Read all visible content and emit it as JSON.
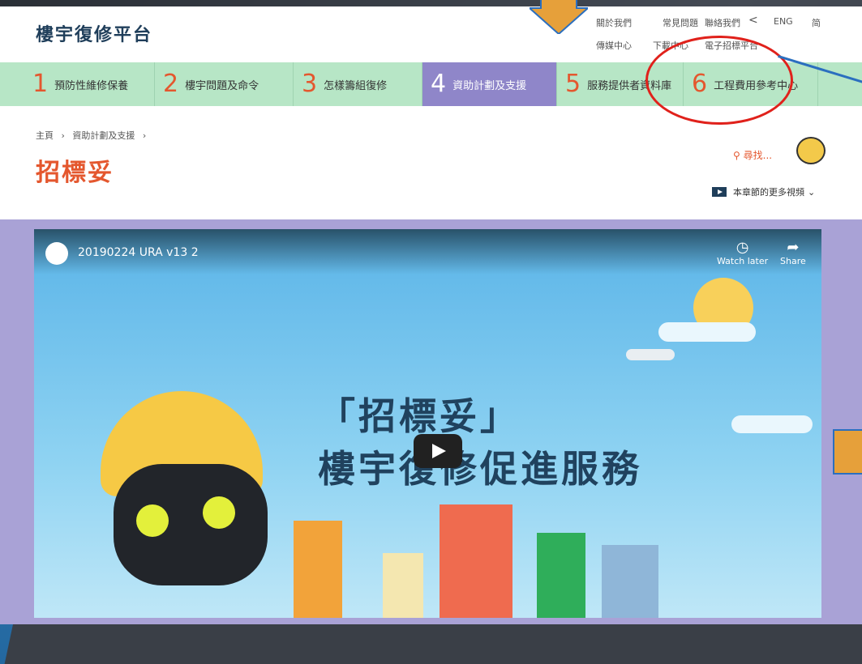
{
  "site": {
    "logo": "樓宇復修平台"
  },
  "top_links": {
    "about": "關於我們",
    "faq": "常見問題",
    "contact": "聯絡我們",
    "lang_en": "ENG",
    "lang_sc": "简",
    "media": "傳媒中心",
    "download": "下載中心",
    "etender": "電子招標平台"
  },
  "nav": [
    {
      "num": "1",
      "label": "預防性維修保養"
    },
    {
      "num": "2",
      "label": "樓宇問題及命令"
    },
    {
      "num": "3",
      "label": "怎樣籌組復修"
    },
    {
      "num": "4",
      "label": "資助計劃及支援"
    },
    {
      "num": "5",
      "label": "服務提供者資料庫"
    },
    {
      "num": "6",
      "label": "工程費用參考中心"
    }
  ],
  "breadcrumb": {
    "home": "主頁",
    "sep": "›",
    "section": "資助計劃及支援",
    "sep2": "›"
  },
  "page_title": "招標妥",
  "search": {
    "label": "尋找..."
  },
  "videos_link": "本章節的更多視頻",
  "video": {
    "title": "20190224 URA v13 2",
    "watch_later": "Watch later",
    "share": "Share",
    "headline_line1": "「招標妥」",
    "headline_line2": "樓宇復修促進服務"
  },
  "colors": {
    "accent": "#e4572e",
    "nav_bg": "#b7e6c6",
    "nav_active": "#8f86c9",
    "annotation_red": "#e0211b",
    "arrow_orange": "#e6a03a"
  }
}
